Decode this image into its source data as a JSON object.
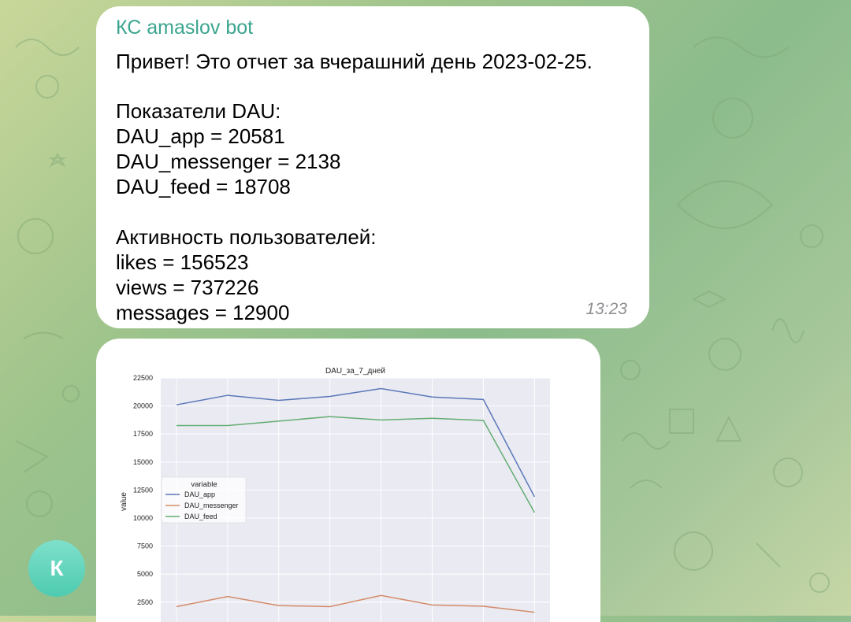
{
  "message": {
    "sender": "КС amaslov bot",
    "lines": [
      "Привет! Это отчет за вчерашний день 2023-02-25.",
      "Показатели DAU:",
      "DAU_app = 20581",
      "DAU_messenger = 2138",
      "DAU_feed = 18708",
      "Активность пользователей:",
      "likes = 156523",
      "views = 737226",
      "messages = 12900"
    ],
    "time": "13:23"
  },
  "avatar": {
    "letter": "К",
    "color": "#5ed3ba"
  },
  "colors": {
    "accent": "#3aa58e",
    "app": "#5a78b8",
    "messenger": "#d48b6a",
    "feed": "#63ad72"
  },
  "chart_data": {
    "type": "line",
    "title": "DAU_за_7_дней",
    "ylabel": "value",
    "xlabel": "",
    "ylim": [
      0,
      22500
    ],
    "yticks": [
      2500,
      5000,
      7500,
      10000,
      12500,
      15000,
      17500,
      20000,
      22500
    ],
    "x": [
      1,
      2,
      3,
      4,
      5,
      6,
      7,
      8
    ],
    "legend": {
      "title": "variable",
      "position": "center-left"
    },
    "grid": true,
    "series": [
      {
        "name": "DAU_app",
        "values": [
          20100,
          20950,
          20500,
          20850,
          21550,
          20800,
          20581,
          11900
        ]
      },
      {
        "name": "DAU_messenger",
        "values": [
          2100,
          3000,
          2200,
          2100,
          3100,
          2250,
          2138,
          1600
        ]
      },
      {
        "name": "DAU_feed",
        "values": [
          18250,
          18250,
          18650,
          19050,
          18750,
          18900,
          18708,
          10500
        ]
      }
    ]
  }
}
